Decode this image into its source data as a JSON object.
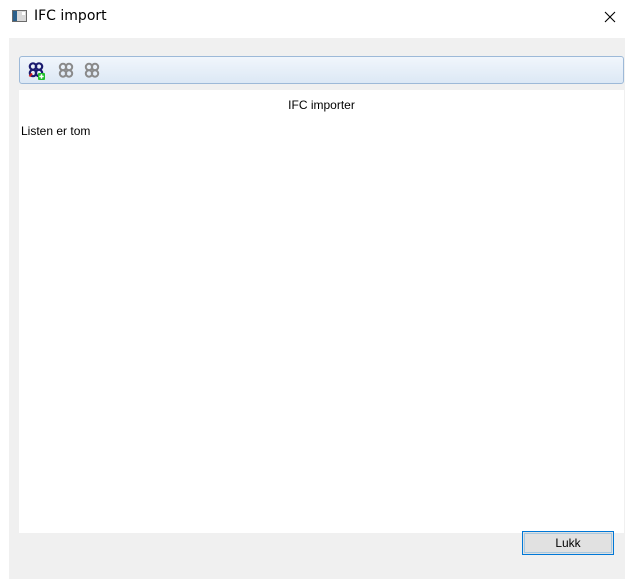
{
  "window": {
    "title": "IFC import",
    "close_glyph": "✕",
    "app_icon": "window-app-icon"
  },
  "toolbar": {
    "buttons": [
      {
        "icon": "ifc-import-add-icon",
        "enabled": true
      },
      {
        "icon": "ifc-import-icon",
        "enabled": false
      },
      {
        "icon": "ifc-import-icon",
        "enabled": false
      }
    ],
    "accent_colors": {
      "knot": "#1a1a6e",
      "green_plus": "#1fbf2a",
      "red_accent": "#d21e1e",
      "disabled": "#8a8a8a"
    }
  },
  "panel": {
    "title": "IFC importer",
    "empty_message": "Listen er tom"
  },
  "footer": {
    "close_label": "Lukk"
  }
}
